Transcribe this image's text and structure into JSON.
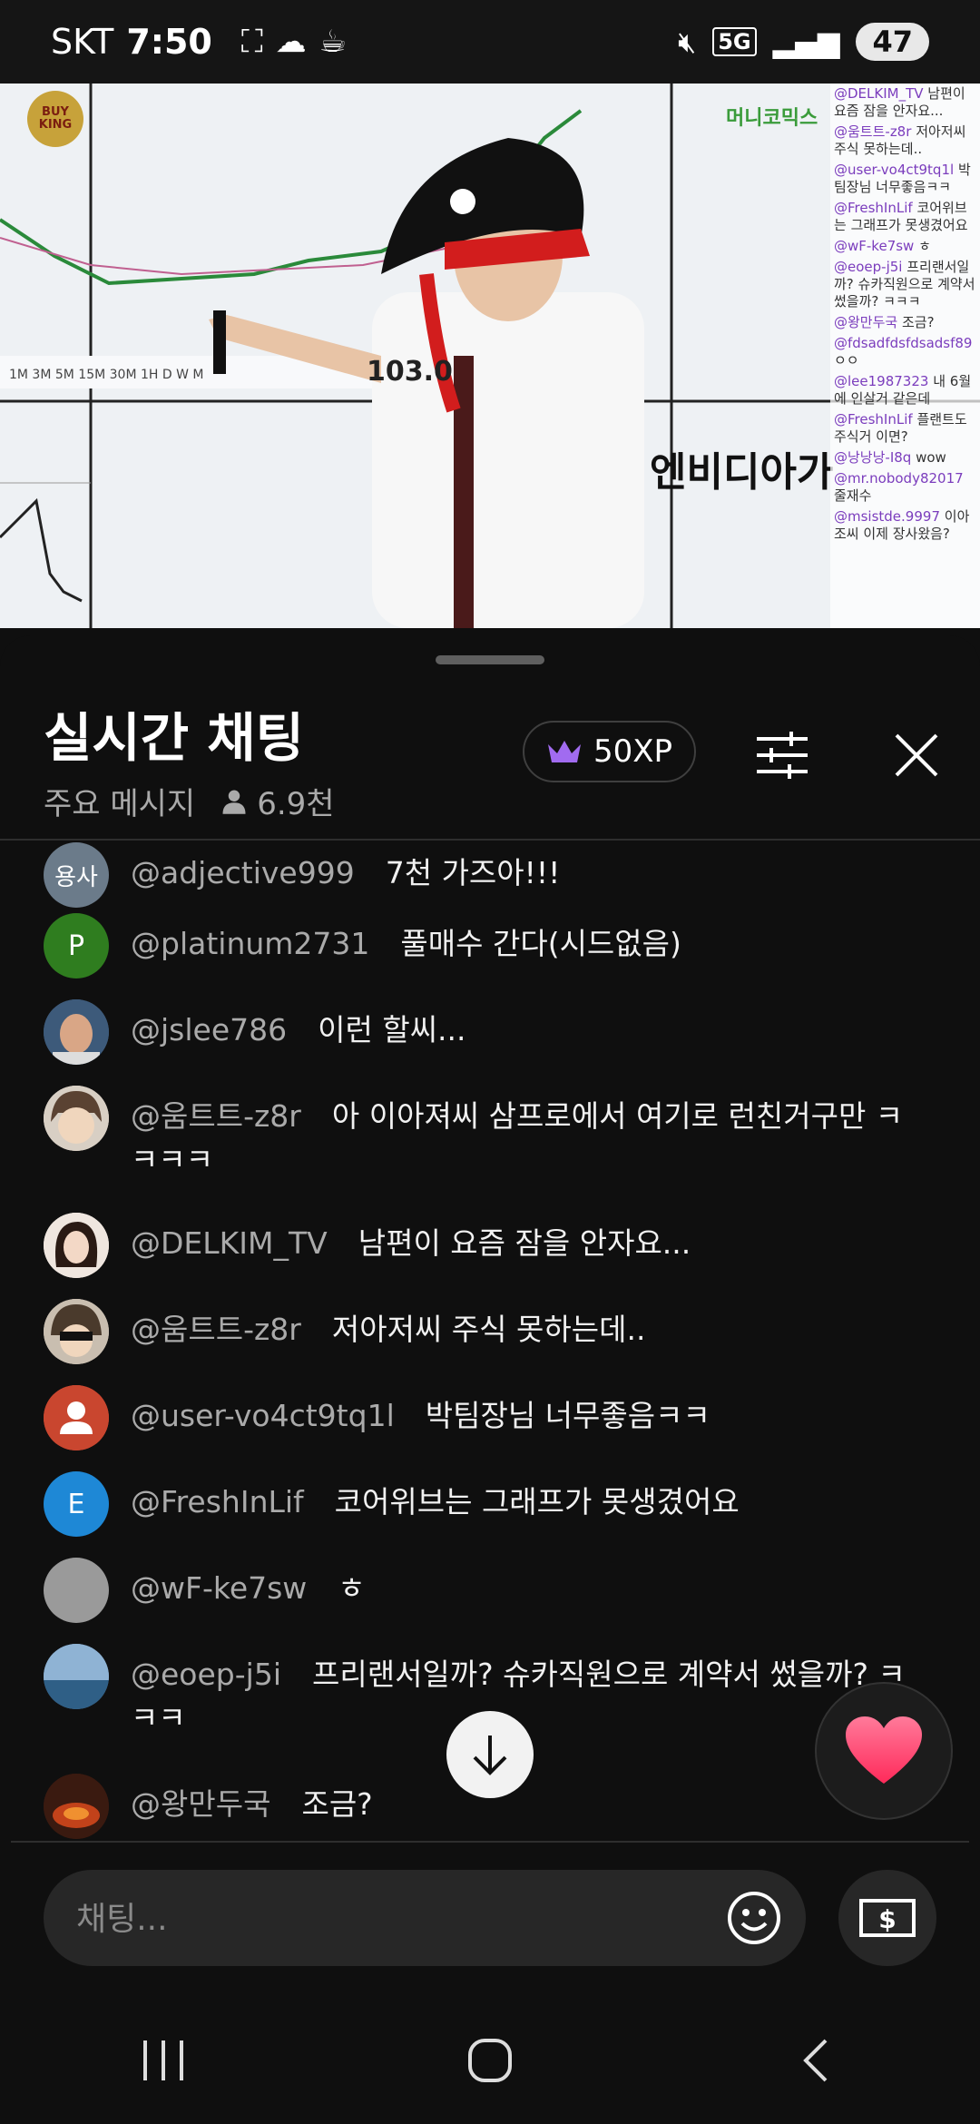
{
  "status_bar": {
    "carrier": "SKT",
    "time": "7:50",
    "network": "5G",
    "battery": "47"
  },
  "video": {
    "logo_text": "BUY KING",
    "brand": "머니코믹스",
    "caption": "엔비디아가",
    "price_label": "103.0",
    "overlay_chat": [
      {
        "name": "@DELKIM_TV",
        "text": "남편이 요즘 잠을 안자요..."
      },
      {
        "name": "@움트트-z8r",
        "text": "저아저씨 주식 못하는데.."
      },
      {
        "name": "@user-vo4ct9tq1l",
        "text": "박팀장님 너무좋음ㅋㅋ"
      },
      {
        "name": "@FreshInLif",
        "text": "코어위브는 그래프가 못생겼어요"
      },
      {
        "name": "@wF-ke7sw",
        "text": "ㅎ"
      },
      {
        "name": "@eoep-j5i",
        "text": "프리랜서일까? 슈카직원으로 계약서 썼을까? ㅋㅋㅋ"
      },
      {
        "name": "@왕만두국",
        "text": "조금?"
      },
      {
        "name": "@fdsadfdsfdsadsf89",
        "text": "ㅇㅇ"
      },
      {
        "name": "@lee1987323",
        "text": "내 6월에 인살거 같은데"
      },
      {
        "name": "@FreshInLif",
        "text": "플랜트도 주식거 이면?"
      },
      {
        "name": "@낭낭낭-I8q",
        "text": "wow"
      },
      {
        "name": "@mr.nobody82017",
        "text": "줄재수"
      },
      {
        "name": "@msistde.9997",
        "text": "이아조씨 이제 장사왔음?"
      }
    ]
  },
  "header": {
    "title": "실시간 채팅",
    "mode": "주요 메시지",
    "viewers": "6.9천",
    "xp_label": "50XP"
  },
  "messages": [
    {
      "author": "@adjective999",
      "text": "7천 가즈아!!!",
      "avatar_text": "용사",
      "avatar_color": "#6b7b8a"
    },
    {
      "author": "@platinum2731",
      "text": "풀매수 간다(시드없음)",
      "avatar_text": "P",
      "avatar_color": "#2f7d1f"
    },
    {
      "author": "@jslee786",
      "text": "이런 할씨...",
      "avatar_text": "",
      "avatar_color": "#3d5a7a"
    },
    {
      "author": "@움트트-z8r",
      "text": "아 이아져씨 삼프로에서 여기로 런친거구만 ㅋㅋㅋㅋ",
      "avatar_text": "",
      "avatar_color": "#8a7a66"
    },
    {
      "author": "@DELKIM_TV",
      "text": "남편이 요즘 잠을 안자요...",
      "avatar_text": "",
      "avatar_color": "#d9c7bd"
    },
    {
      "author": "@움트트-z8r",
      "text": "저아저씨 주식 못하는데..",
      "avatar_text": "",
      "avatar_color": "#7a6a58"
    },
    {
      "author": "@user-vo4ct9tq1l",
      "text": "박팀장님 너무좋음ㅋㅋ",
      "avatar_text": "",
      "avatar_color": "#c9462f"
    },
    {
      "author": "@FreshInLif",
      "text": "코어위브는 그래프가 못생겼어요",
      "avatar_text": "E",
      "avatar_color": "#1e88d6"
    },
    {
      "author": "@wF-ke7sw",
      "text": "ㅎ",
      "avatar_text": "",
      "avatar_color": "#9a9a9a"
    },
    {
      "author": "@eoep-j5i",
      "text": "프리랜서일까? 슈카직원으로 계약서 썼을까? ㅋㅋㅋ",
      "avatar_text": "",
      "avatar_color": "#5a82a8"
    },
    {
      "author": "@왕만두국",
      "text": "조금?",
      "avatar_text": "",
      "avatar_color": "#8a3a1f"
    }
  ],
  "input": {
    "placeholder": "채팅..."
  },
  "colors": {
    "background": "#0f0f0f",
    "author": "#aaaaaa",
    "crown": "#a16bf0",
    "heart": "#ff3c6e"
  }
}
